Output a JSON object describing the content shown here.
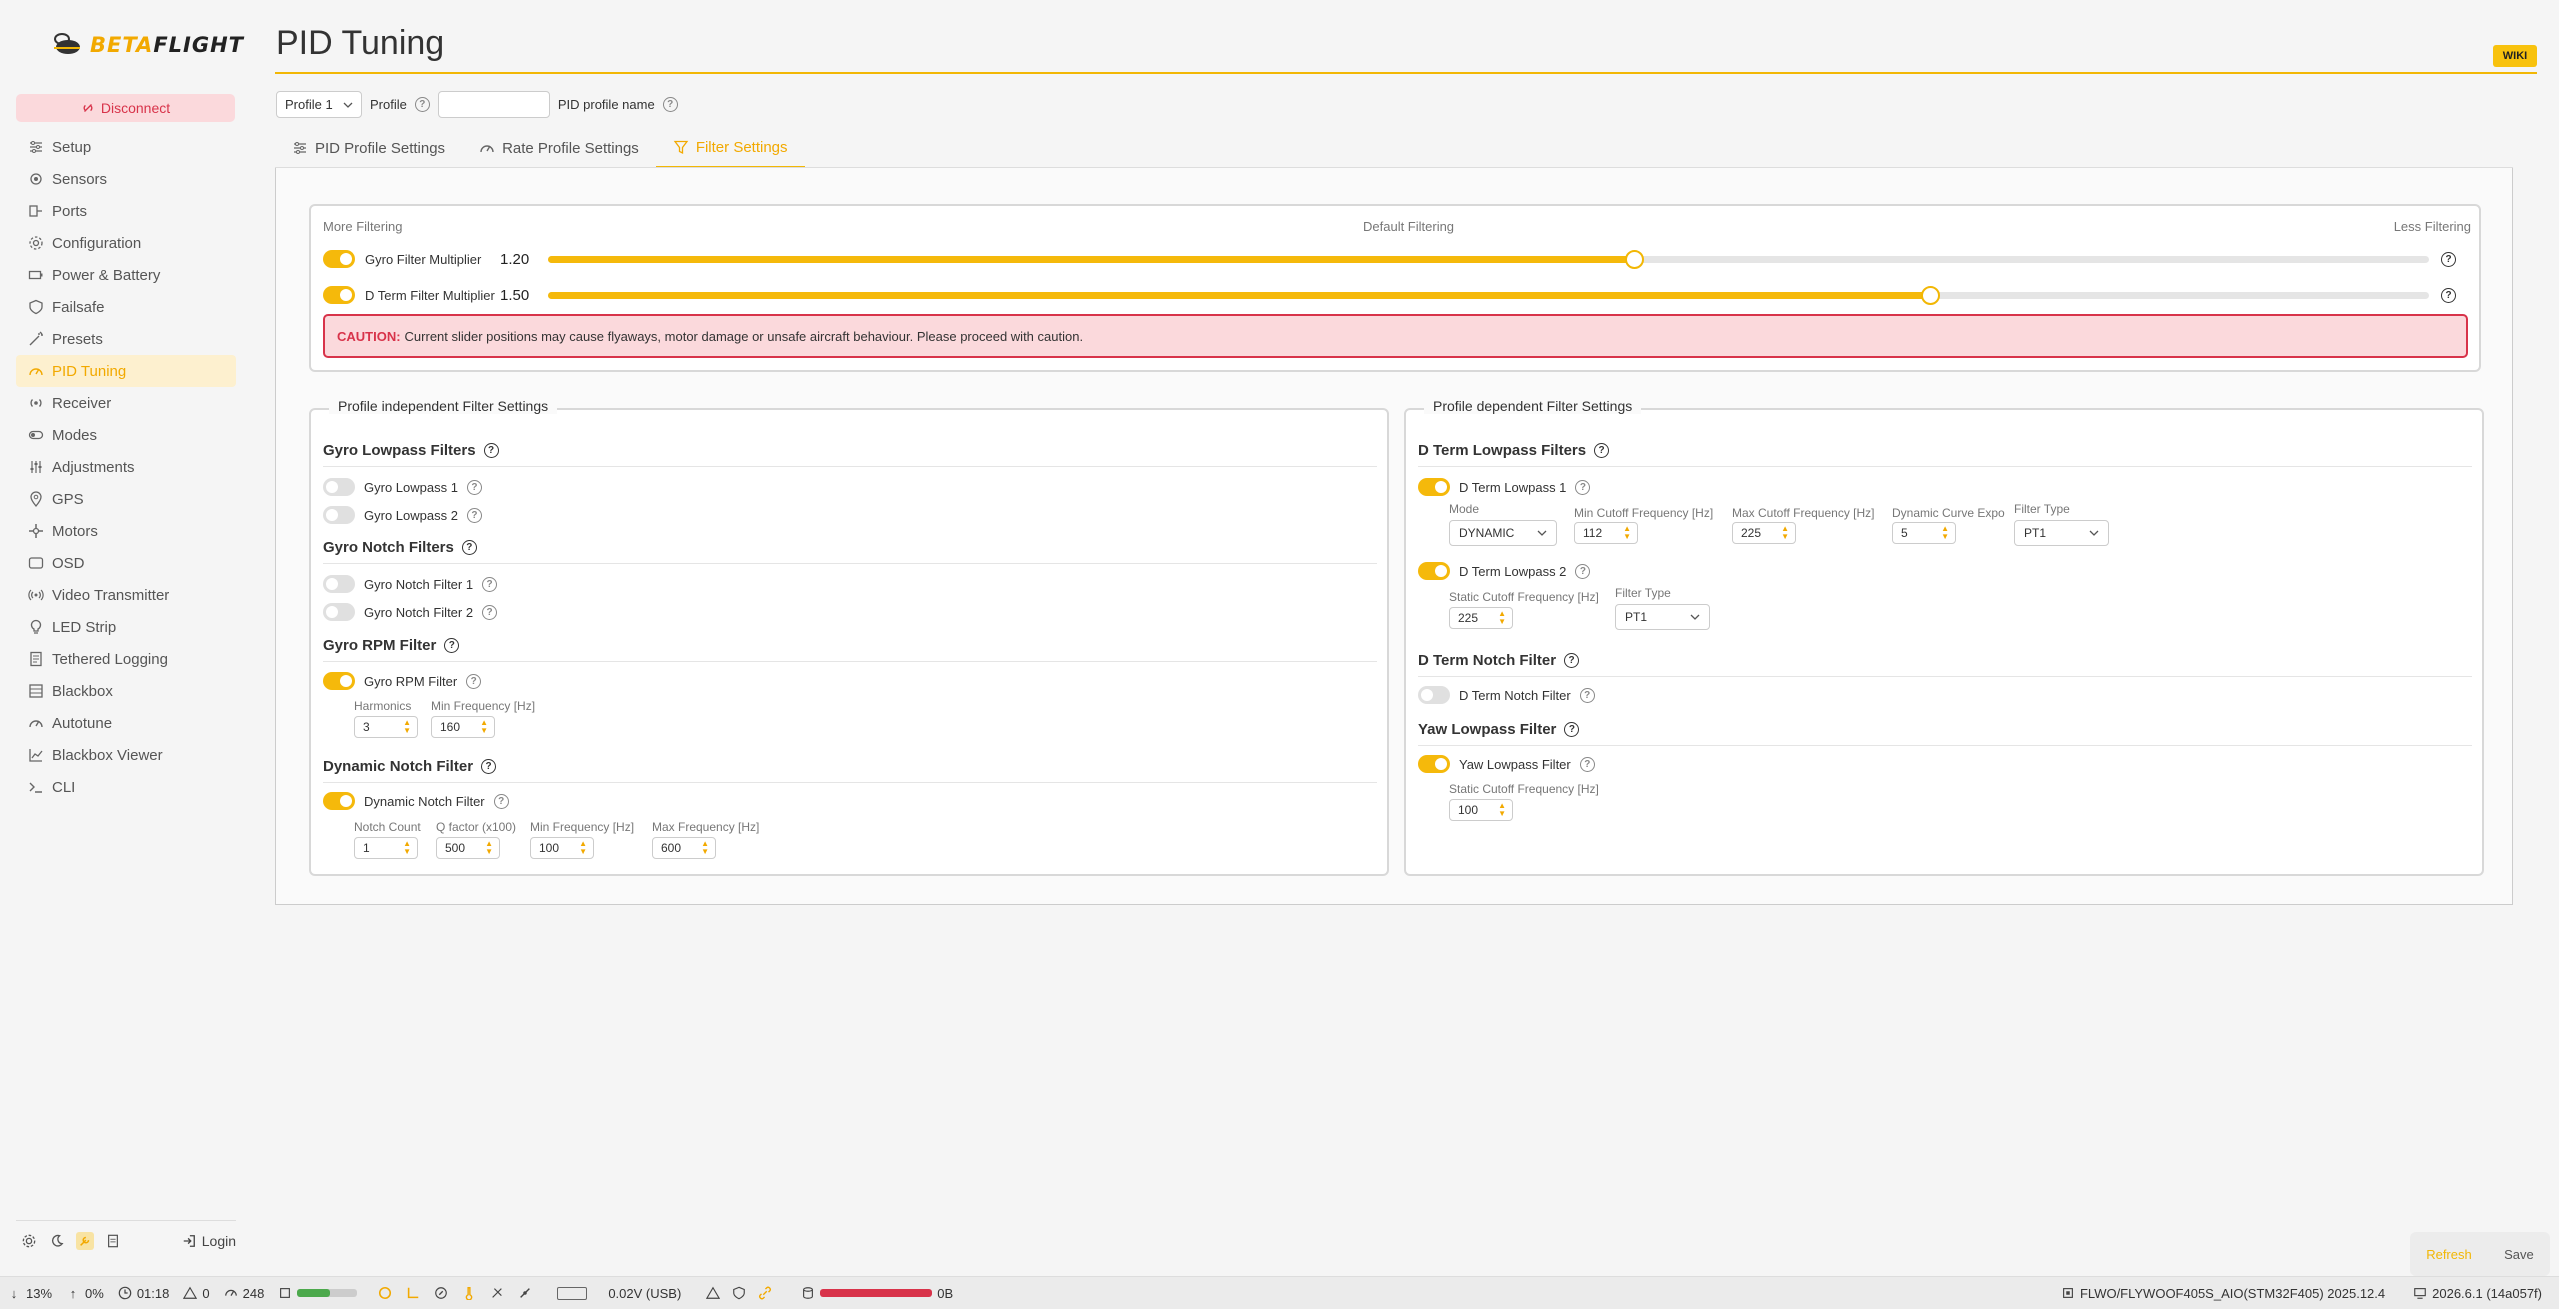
{
  "app": {
    "logo_beta": "BETA",
    "logo_flight": "FLIGHT",
    "disconnect": "Disconnect"
  },
  "nav": [
    {
      "label": "Setup",
      "icon": "sliders-icon"
    },
    {
      "label": "Sensors",
      "icon": "sensor-icon"
    },
    {
      "label": "Ports",
      "icon": "ports-icon"
    },
    {
      "label": "Configuration",
      "icon": "gear-icon"
    },
    {
      "label": "Power & Battery",
      "icon": "battery-icon"
    },
    {
      "label": "Failsafe",
      "icon": "shield-icon"
    },
    {
      "label": "Presets",
      "icon": "wand-icon"
    },
    {
      "label": "PID Tuning",
      "icon": "gauge-icon",
      "active": true
    },
    {
      "label": "Receiver",
      "icon": "radio-icon"
    },
    {
      "label": "Modes",
      "icon": "toggle-icon"
    },
    {
      "label": "Adjustments",
      "icon": "adjust-icon"
    },
    {
      "label": "GPS",
      "icon": "pin-icon"
    },
    {
      "label": "Motors",
      "icon": "motor-icon"
    },
    {
      "label": "OSD",
      "icon": "screen-icon"
    },
    {
      "label": "Video Transmitter",
      "icon": "broadcast-icon"
    },
    {
      "label": "LED Strip",
      "icon": "bulb-icon"
    },
    {
      "label": "Tethered Logging",
      "icon": "log-icon"
    },
    {
      "label": "Blackbox",
      "icon": "database-icon"
    },
    {
      "label": "Autotune",
      "icon": "gauge-icon"
    },
    {
      "label": "Blackbox Viewer",
      "icon": "chart-icon"
    },
    {
      "label": "CLI",
      "icon": "terminal-icon"
    }
  ],
  "side_bottom": {
    "login": "Login"
  },
  "page": {
    "title": "PID Tuning",
    "wiki": "WIKI"
  },
  "profile": {
    "select": "Profile 1",
    "label": "Profile",
    "name_label": "PID profile name",
    "name_value": ""
  },
  "tabs": [
    {
      "label": "PID Profile Settings",
      "icon": "sliders-icon"
    },
    {
      "label": "Rate Profile Settings",
      "icon": "gauge-icon"
    },
    {
      "label": "Filter Settings",
      "icon": "filter-icon",
      "active": true
    }
  ],
  "sliders": {
    "more": "More Filtering",
    "default": "Default Filtering",
    "less": "Less Filtering",
    "gyro": {
      "label": "Gyro Filter Multiplier",
      "value": "1.20",
      "fraction": 0.578,
      "enabled": true
    },
    "dterm": {
      "label": "D Term Filter Multiplier",
      "value": "1.50",
      "fraction": 0.735,
      "enabled": true
    },
    "caution_title": "CAUTION:",
    "caution_text": "Current slider positions may cause flyaways, motor damage or unsafe aircraft behaviour. Please proceed with caution."
  },
  "left": {
    "legend": "Profile independent Filter Settings",
    "gyro_lp_title": "Gyro Lowpass Filters",
    "gyro_lp1": "Gyro Lowpass 1",
    "gyro_lp2": "Gyro Lowpass 2",
    "gyro_notch_title": "Gyro Notch Filters",
    "gyro_notch1": "Gyro Notch Filter 1",
    "gyro_notch2": "Gyro Notch Filter 2",
    "rpm_title": "Gyro RPM Filter",
    "rpm_toggle": "Gyro RPM Filter",
    "harmonics_label": "Harmonics",
    "harmonics": "3",
    "rpm_min_label": "Min Frequency [Hz]",
    "rpm_min": "160",
    "dyn_title": "Dynamic Notch Filter",
    "dyn_toggle": "Dynamic Notch Filter",
    "notch_count_label": "Notch Count",
    "notch_count": "1",
    "q_label": "Q factor (x100)",
    "q": "500",
    "dyn_min_label": "Min Frequency [Hz]",
    "dyn_min": "100",
    "dyn_max_label": "Max Frequency [Hz]",
    "dyn_max": "600"
  },
  "right": {
    "legend": "Profile dependent Filter Settings",
    "dterm_lp_title": "D Term Lowpass Filters",
    "dlp1": "D Term Lowpass 1",
    "mode_label": "Mode",
    "mode": "DYNAMIC",
    "min_cut_label": "Min Cutoff Frequency [Hz]",
    "min_cut": "112",
    "max_cut_label": "Max Cutoff Frequency [Hz]",
    "max_cut": "225",
    "expo_label": "Dynamic Curve Expo",
    "expo": "5",
    "ftype_label": "Filter Type",
    "ftype1": "PT1",
    "dlp2": "D Term Lowpass 2",
    "static_label": "Static Cutoff Frequency [Hz]",
    "static": "225",
    "ftype2_label": "Filter Type",
    "ftype2": "PT1",
    "dnotch_title": "D Term Notch Filter",
    "dnotch": "D Term Notch Filter",
    "yaw_title": "Yaw Lowpass Filter",
    "yaw": "Yaw Lowpass Filter",
    "yaw_static_label": "Static Cutoff Frequency [Hz]",
    "yaw_static": "100"
  },
  "actions": {
    "refresh": "Refresh",
    "save": "Save"
  },
  "status": {
    "down": "13%",
    "up": "0%",
    "time": "01:18",
    "warnings": "0",
    "cycle": "248",
    "cpu_fraction": 0.55,
    "voltage": "0.02V (USB)",
    "log": "0B",
    "firmware": "FLWO/FLYWOOF405S_AIO(STM32F405) 2025.12.4",
    "version": "2026.6.1 (14a057f)"
  },
  "colors": {
    "accent": "#f2b705",
    "danger": "#d8334a"
  }
}
